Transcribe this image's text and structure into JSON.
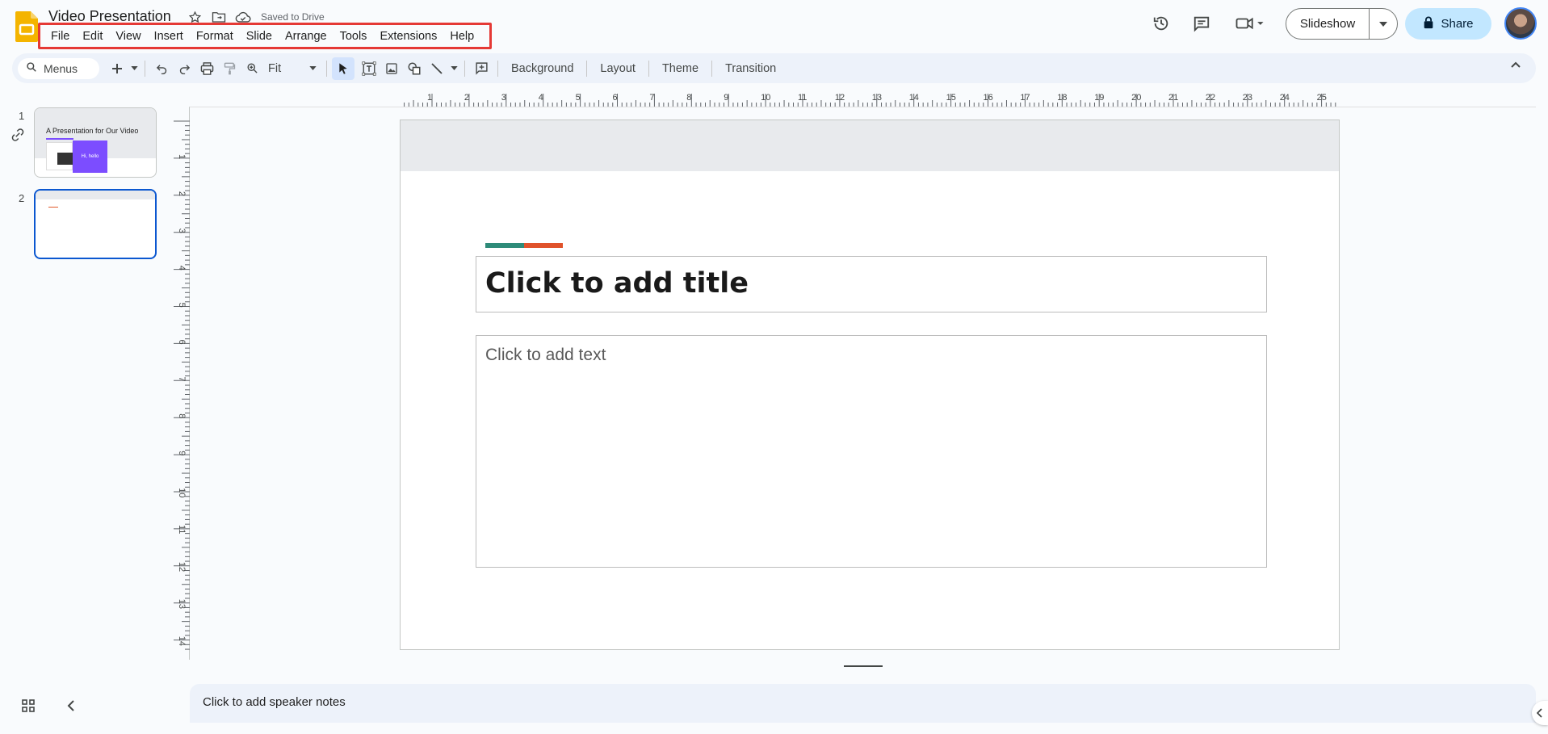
{
  "app": {
    "name": "Google Slides",
    "brand_color": "#f4b400"
  },
  "doc": {
    "title": "Video Presentation",
    "saved_status": "Saved to Drive"
  },
  "menubar": {
    "items": [
      "File",
      "Edit",
      "View",
      "Insert",
      "Format",
      "Slide",
      "Arrange",
      "Tools",
      "Extensions",
      "Help"
    ],
    "highlight_color": "#e53935"
  },
  "header": {
    "icons": [
      "history-icon",
      "comment-icon",
      "meet-icon"
    ],
    "slideshow_label": "Slideshow",
    "share_label": "Share"
  },
  "toolbar": {
    "search_label": "Menus",
    "zoom_value": "Fit",
    "background_label": "Background",
    "layout_label": "Layout",
    "theme_label": "Theme",
    "transition_label": "Transition"
  },
  "filmstrip": {
    "slides": [
      {
        "number": "1",
        "title": "A Presentation for Our Video",
        "card_text": "Hi, hello"
      },
      {
        "number": "2"
      }
    ]
  },
  "rulers": {
    "horizontal": [
      "1",
      "2",
      "3",
      "4",
      "5",
      "6",
      "7",
      "8",
      "9",
      "10",
      "11",
      "12",
      "13",
      "14",
      "15",
      "16",
      "17",
      "18",
      "19",
      "20",
      "21",
      "22",
      "23",
      "24",
      "25"
    ],
    "vertical": [
      "1",
      "2",
      "3",
      "4",
      "5",
      "6",
      "7",
      "8",
      "9",
      "10",
      "11",
      "12",
      "13",
      "14"
    ]
  },
  "slide": {
    "title_placeholder": "Click to add title",
    "body_placeholder": "Click to add text",
    "accent_colors": [
      "#2e8b79",
      "#e0522b"
    ]
  },
  "notes": {
    "placeholder": "Click to add speaker notes"
  },
  "colors": {
    "accent_blue": "#0b57d0",
    "share_bg": "#c2e7ff",
    "toolbar_bg": "#edf2fa"
  }
}
